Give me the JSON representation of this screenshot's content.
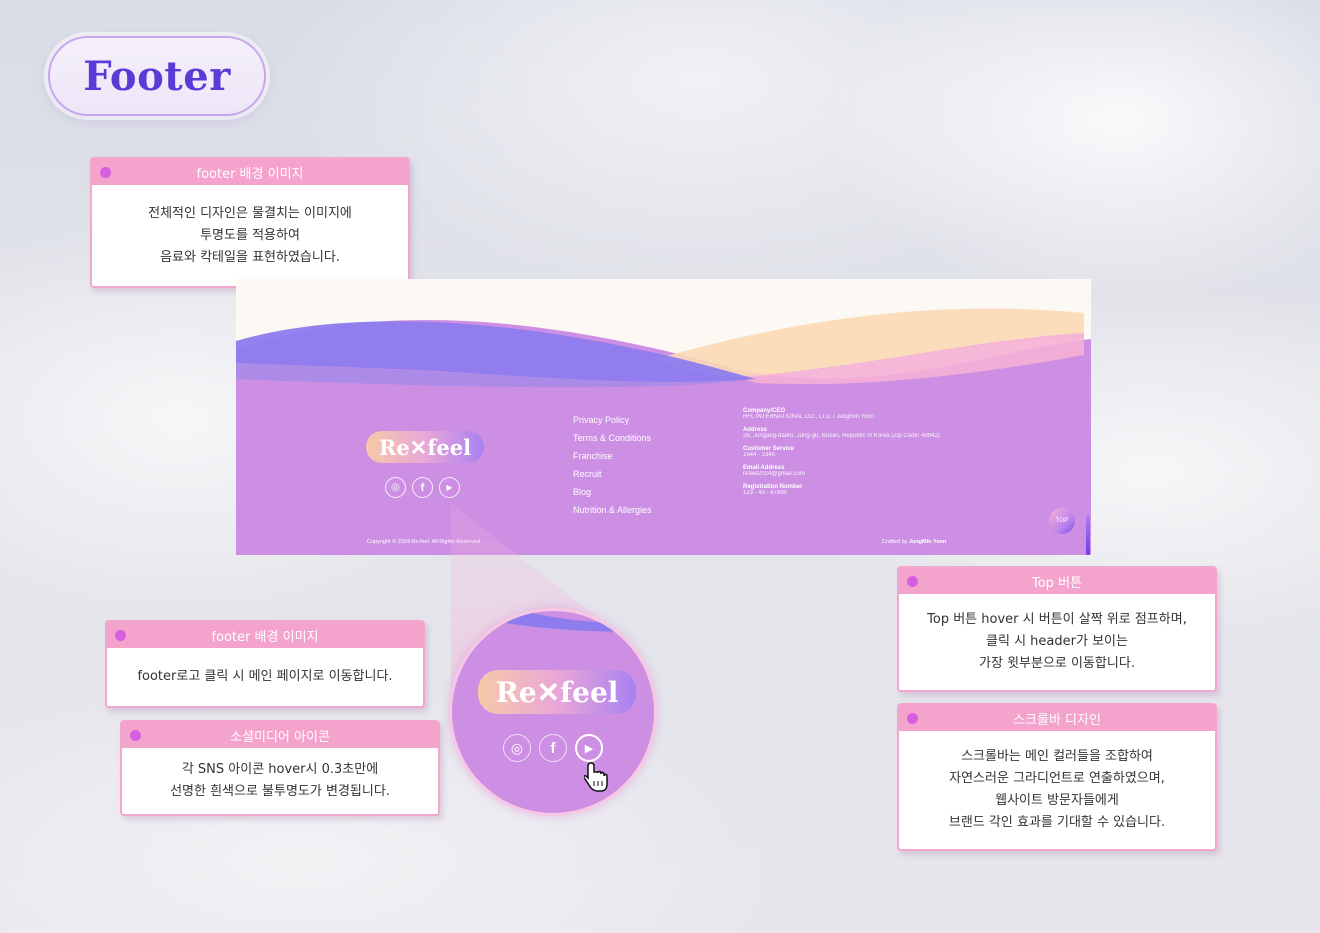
{
  "page_title": "Footer",
  "colors": {
    "accent": "#5b3bd6",
    "card_header": "#f4a3cc",
    "footer_purple": "#cc8fe3"
  },
  "cards": {
    "bg_image": {
      "title": "footer 배경 이미지",
      "lines": [
        "전체적인 디자인은 물결치는 이미지에",
        "투명도를 적용하여",
        "음료와 칵테일을 표현하였습니다."
      ]
    },
    "logo": {
      "title": "footer 배경 이미지",
      "lines": [
        "footer로고 클릭 시 메인 페이지로 이동합니다."
      ]
    },
    "sns": {
      "title": "소셜미디어 아이콘",
      "lines": [
        "각 SNS 아이콘 hover시 0.3초만에",
        "선명한 흰색으로 불투명도가 변경됩니다."
      ]
    },
    "top": {
      "title": "Top 버튼",
      "lines": [
        "Top 버튼 hover 시 버튼이 살짝 위로 점프하며,",
        "클릭 시 header가 보이는",
        "가장 윗부분으로 이동합니다."
      ]
    },
    "scrollbar": {
      "title": "스크롤바 디자인",
      "lines": [
        "스크롤바는 메인 컬러들을 조합하여",
        "자연스러운 그라디언트로 연출하였으며,",
        "웹사이트 방문자들에게",
        "브랜드 각인 효과를 기대할 수 있습니다."
      ]
    }
  },
  "footer": {
    "logo_text": "Re✕feel",
    "links": [
      "Privacy Policy",
      "Terms & Conditions",
      "Franchise",
      "Recruit",
      "Blog",
      "Nutrition & Allergies"
    ],
    "info": [
      {
        "label": "Company/CEO",
        "value": "RFL INTERNATIONAL CO., LTD. / Jungmin Yoon"
      },
      {
        "label": "Address",
        "value": "26, Jungang-daero, Jung-gu, Busan, Republic of Korea (Zip Code: 48942)"
      },
      {
        "label": "Customer Service",
        "value": "1644 - 2345"
      },
      {
        "label": "Email Address",
        "value": "refeel2024@gmail.com"
      },
      {
        "label": "Registration Number",
        "value": "123 - 45 - 67890"
      }
    ],
    "copyright": "Copyright © 2024 Re:feel. All Rights Reserved.",
    "crafted_prefix": "Crafted by",
    "crafted_name": "JungMin Yoon",
    "top_label": "TOP",
    "sns_icons": [
      "instagram-icon",
      "facebook-icon",
      "youtube-icon"
    ]
  }
}
